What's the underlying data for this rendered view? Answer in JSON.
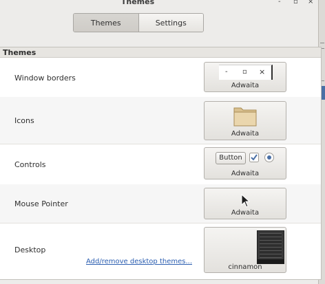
{
  "window": {
    "title": "Themes",
    "controls": {
      "minimize": "-",
      "maximize": "▫",
      "close": "×"
    }
  },
  "tabs": [
    {
      "label": "Themes",
      "active": true
    },
    {
      "label": "Settings",
      "active": false
    }
  ],
  "section_title": "Themes",
  "rows": {
    "window_borders": {
      "label": "Window borders",
      "theme": "Adwaita",
      "preview_buttons": {
        "minimize": "-",
        "maximize": "▫",
        "close": "×"
      }
    },
    "icons": {
      "label": "Icons",
      "theme": "Adwaita"
    },
    "controls": {
      "label": "Controls",
      "theme": "Adwaita",
      "preview_button": "Button"
    },
    "mouse_pointer": {
      "label": "Mouse Pointer",
      "theme": "Adwaita"
    },
    "desktop": {
      "label": "Desktop",
      "theme": "cinnamon",
      "link": "Add/remove desktop themes..."
    }
  },
  "colors": {
    "accent": "#4a6fa5",
    "link": "#2a5db0",
    "folder": "#e8d3a8"
  }
}
